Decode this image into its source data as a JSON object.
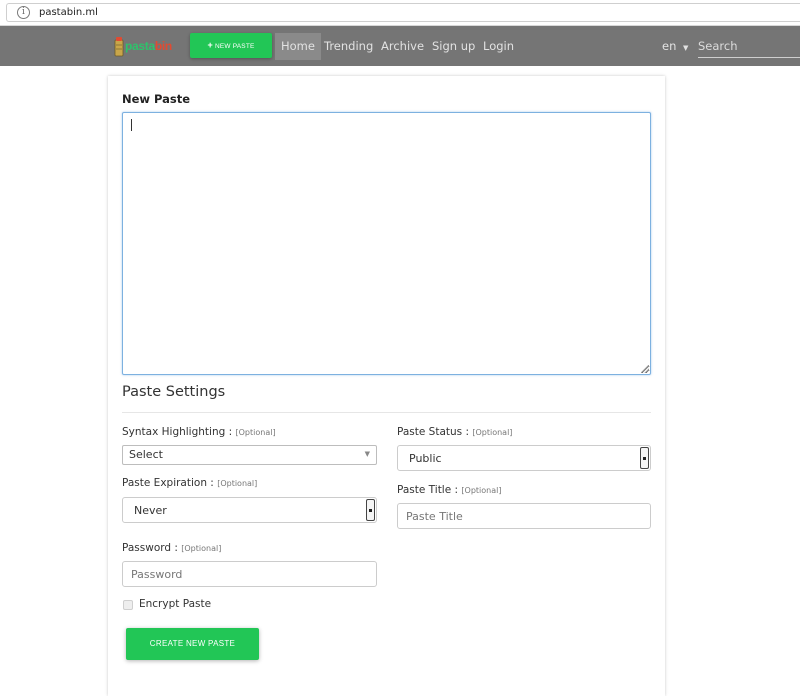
{
  "browser": {
    "url": "pastabin.ml"
  },
  "navbar": {
    "logo": {
      "part1": "pasta",
      "part2": "bin"
    },
    "new_paste_button": "NEW PASTE",
    "links": {
      "home": "Home",
      "trending": "Trending",
      "archive": "Archive",
      "signup": "Sign up",
      "login": "Login"
    },
    "language": "en",
    "search_placeholder": "Search"
  },
  "form": {
    "title": "New Paste",
    "settings_title": "Paste Settings",
    "optional_tag": "[Optional]",
    "syntax": {
      "label": "Syntax Highlighting :",
      "value": "Select"
    },
    "expiration": {
      "label": "Paste Expiration :",
      "value": "Never"
    },
    "status": {
      "label": "Paste Status :",
      "value": "Public"
    },
    "paste_title": {
      "label": "Paste Title :",
      "placeholder": "Paste Title"
    },
    "password": {
      "label": "Password :",
      "placeholder": "Password"
    },
    "encrypt_label": "Encrypt Paste",
    "create_button": "CREATE NEW PASTE"
  },
  "colors": {
    "accent": "#22c656",
    "navbar": "#757575"
  }
}
